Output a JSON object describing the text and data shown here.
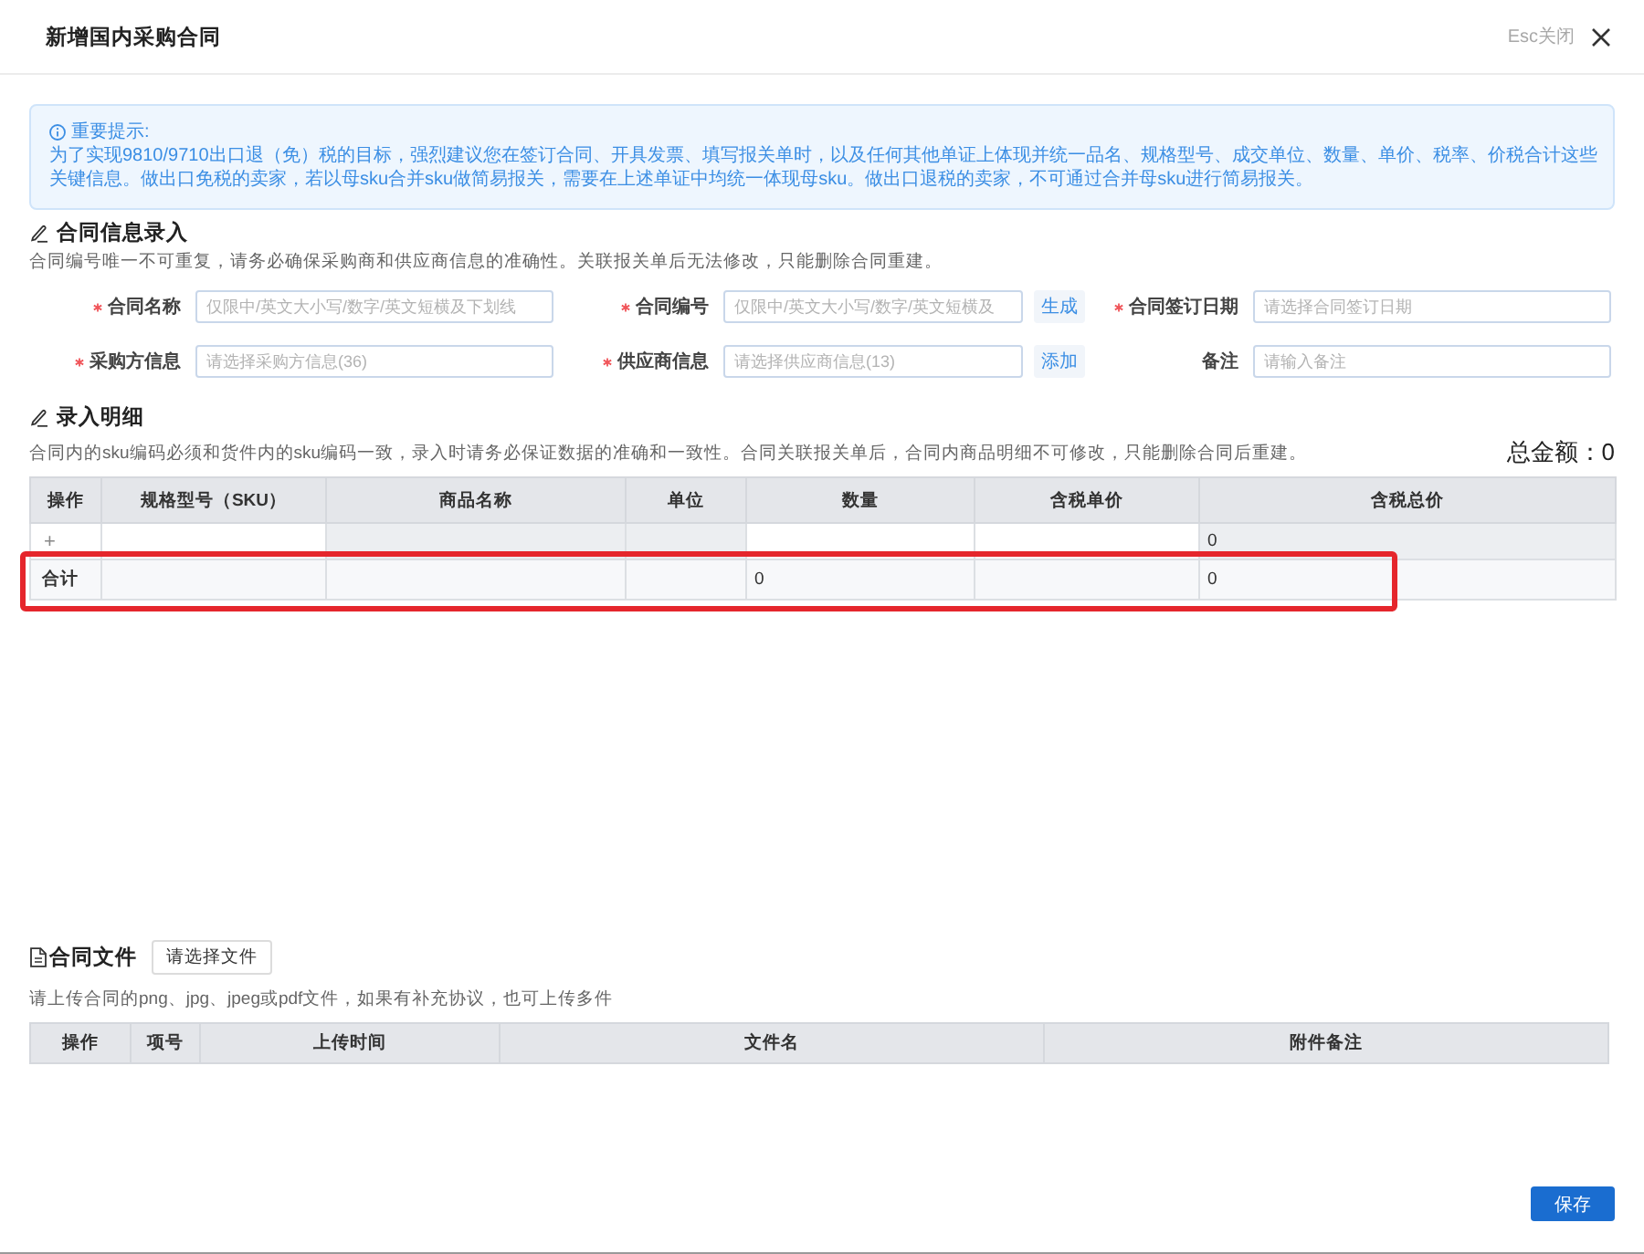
{
  "dialog": {
    "title": "新增国内采购合同",
    "close_hint": "Esc关闭"
  },
  "notice": {
    "heading": "重要提示:",
    "text": "为了实现9810/9710出口退（免）税的目标，强烈建议您在签订合同、开具发票、填写报关单时，以及任何其他单证上体现并统一品名、规格型号、成交单位、数量、单价、税率、价税合计这些关键信息。做出口免税的卖家，若以母sku合并sku做简易报关，需要在上述单证中均统一体现母sku。做出口退税的卖家，不可通过合并母sku进行简易报关。"
  },
  "contract_info": {
    "title": "合同信息录入",
    "description": "合同编号唯一不可重复，请务必确保采购商和供应商信息的准确性。关联报关单后无法修改，只能删除合同重建。",
    "fields": [
      {
        "label": "合同名称",
        "required": true,
        "placeholder": "仅限中/英文大小写/数字/英文短横及下划线"
      },
      {
        "label": "合同编号",
        "required": true,
        "placeholder": "仅限中/英文大小写/数字/英文短横及",
        "action": "生成"
      },
      {
        "label": "合同签订日期",
        "required": true,
        "placeholder": "请选择合同签订日期"
      },
      {
        "label": "采购方信息",
        "required": true,
        "placeholder": "请选择采购方信息(36)"
      },
      {
        "label": "供应商信息",
        "required": true,
        "placeholder": "请选择供应商信息(13)",
        "action": "添加"
      },
      {
        "label": "备注",
        "required": false,
        "placeholder": "请输入备注"
      }
    ]
  },
  "details": {
    "title": "录入明细",
    "description": "合同内的sku编码必须和货件内的sku编码一致，录入时请务必保证数据的准确和一致性。合同关联报关单后，合同内商品明细不可修改，只能删除合同后重建。",
    "total": "总金额：0",
    "columns": [
      "操作",
      "规格型号（SKU）",
      "商品名称",
      "单位",
      "数量",
      "含税单价",
      "含税总价"
    ],
    "rows": [
      {
        "kind": "entry",
        "highlighted": false,
        "cells": [
          {
            "text": "+",
            "disabled": false
          },
          {
            "disabled": false
          },
          {
            "disabled": true
          },
          {
            "disabled": true
          },
          {
            "disabled": false
          },
          {
            "disabled": false
          },
          {
            "text": "0",
            "disabled": true
          }
        ]
      },
      {
        "kind": "total",
        "highlighted": true,
        "cells": [
          "合计",
          null,
          null,
          null,
          "0",
          null,
          "0"
        ]
      }
    ]
  },
  "files": {
    "title": "合同文件",
    "button": "请选择文件",
    "description": "请上传合同的png、jpg、jpeg或pdf文件，如果有补充协议，也可上传多件",
    "columns": [
      "操作",
      "项号",
      "上传时间",
      "文件名",
      "附件备注"
    ]
  },
  "buttons": [
    "保存"
  ]
}
